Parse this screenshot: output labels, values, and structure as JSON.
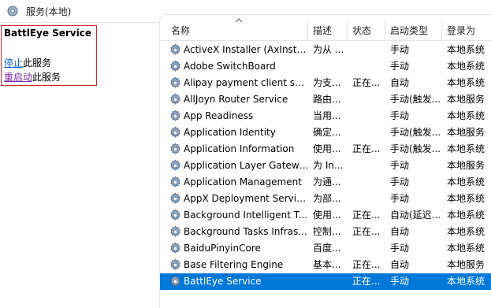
{
  "window": {
    "title": "服务(本地)"
  },
  "details": {
    "service_name": "BattlEye Service",
    "actions": [
      {
        "link": "停止",
        "suffix": "此服务"
      },
      {
        "link": "重启动",
        "suffix": "此服务"
      }
    ]
  },
  "columns": [
    "名称",
    "描述",
    "状态",
    "启动类型",
    "登录为"
  ],
  "rows": [
    {
      "name": "ActiveX Installer (AxInstSV)",
      "desc": "为从 ...",
      "status": "",
      "startup": "手动",
      "logon": "本地系统"
    },
    {
      "name": "Adobe SwitchBoard",
      "desc": "",
      "status": "",
      "startup": "手动",
      "logon": "本地系统"
    },
    {
      "name": "Alipay payment client sec...",
      "desc": "为支...",
      "status": "正在...",
      "startup": "自动",
      "logon": "本地系统"
    },
    {
      "name": "AllJoyn Router Service",
      "desc": "路由...",
      "status": "",
      "startup": "手动(触发...",
      "logon": "本地服务"
    },
    {
      "name": "App Readiness",
      "desc": "当用...",
      "status": "",
      "startup": "手动",
      "logon": "本地系统"
    },
    {
      "name": "Application Identity",
      "desc": "确定...",
      "status": "",
      "startup": "手动(触发...",
      "logon": "本地服务"
    },
    {
      "name": "Application Information",
      "desc": "使用...",
      "status": "正在...",
      "startup": "手动(触发...",
      "logon": "本地系统"
    },
    {
      "name": "Application Layer Gatewa...",
      "desc": "为 In...",
      "status": "",
      "startup": "手动",
      "logon": "本地服务"
    },
    {
      "name": "Application Management",
      "desc": "为通...",
      "status": "",
      "startup": "手动",
      "logon": "本地系统"
    },
    {
      "name": "AppX Deployment Servic...",
      "desc": "为部...",
      "status": "",
      "startup": "手动",
      "logon": "本地系统"
    },
    {
      "name": "Background Intelligent T...",
      "desc": "使用...",
      "status": "正在...",
      "startup": "自动(延迟...",
      "logon": "本地系统"
    },
    {
      "name": "Background Tasks Infras...",
      "desc": "控制...",
      "status": "正在...",
      "startup": "自动",
      "logon": "本地系统"
    },
    {
      "name": "BaiduPinyinCore",
      "desc": "百度...",
      "status": "",
      "startup": "手动",
      "logon": "本地系统"
    },
    {
      "name": "Base Filtering Engine",
      "desc": "基本...",
      "status": "正在...",
      "startup": "自动",
      "logon": "本地服务"
    },
    {
      "name": "BattlEye Service",
      "desc": "",
      "status": "正在...",
      "startup": "手动",
      "logon": "本地系统",
      "selected": true
    }
  ],
  "colors": {
    "selection": "#0078d7",
    "frame": "#c62828",
    "link": "#0a61c7"
  }
}
